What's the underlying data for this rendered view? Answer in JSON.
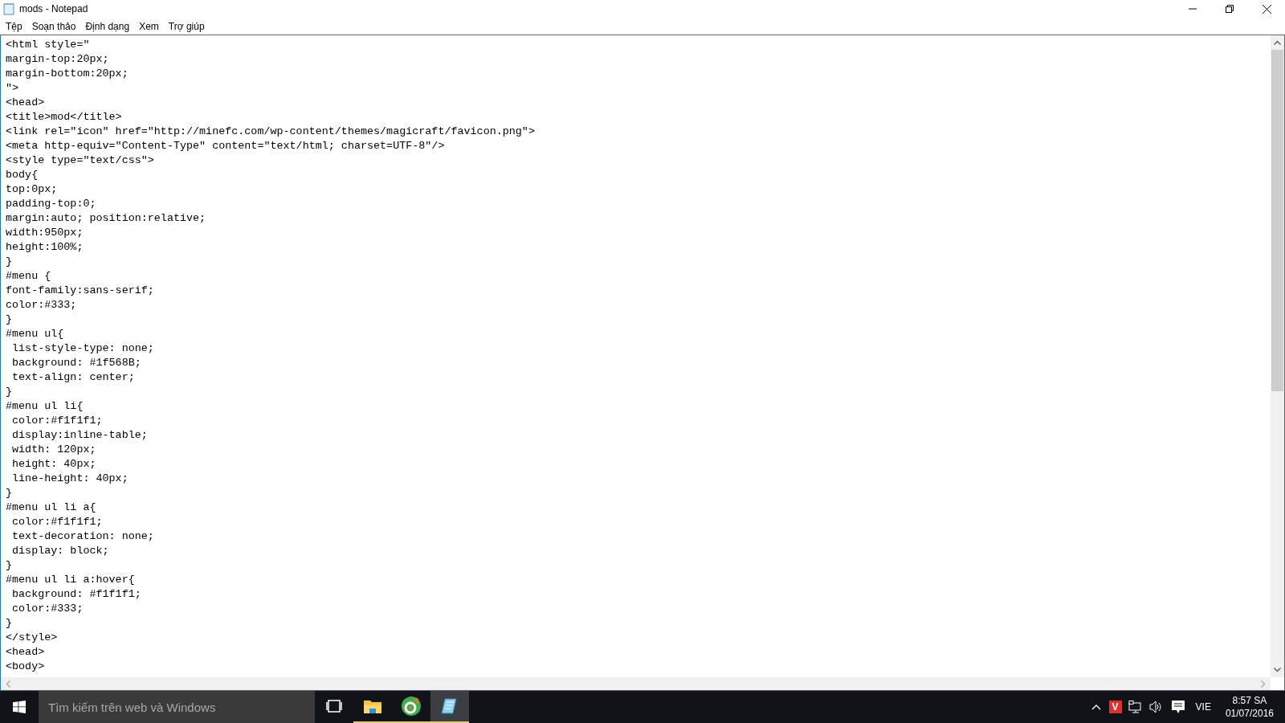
{
  "window": {
    "title": "mods - Notepad"
  },
  "menu": [
    {
      "label": "Tệp"
    },
    {
      "label": "Soạn thảo"
    },
    {
      "label": "Định dạng"
    },
    {
      "label": "Xem"
    },
    {
      "label": "Trợ giúp"
    }
  ],
  "editor": {
    "lines": [
      "<html style=\"",
      "margin-top:20px;",
      "margin-bottom:20px;",
      "\">",
      "<head>",
      "<title>mod</title>",
      "<link rel=\"icon\" href=\"http://minefc.com/wp-content/themes/magicraft/favicon.png\">",
      "<meta http-equiv=\"Content-Type\" content=\"text/html; charset=UTF-8\"/>",
      "<style type=\"text/css\">",
      "body{",
      "top:0px;",
      "padding-top:0;",
      "margin:auto; position:relative;",
      "width:950px;",
      "height:100%;",
      "}",
      "#menu {",
      "font-family:sans-serif;",
      "color:#333;",
      "}",
      "#menu ul{",
      " list-style-type: none;",
      " background: #1f568B;",
      " text-align: center;",
      "}",
      "#menu ul li{",
      " color:#f1f1f1;",
      " display:inline-table;",
      " width: 120px;",
      " height: 40px;",
      " line-height: 40px;",
      "}",
      "#menu ul li a{",
      " color:#f1f1f1;",
      " text-decoration: none;",
      " display: block;",
      "}",
      "#menu ul li a:hover{",
      " background: #f1f1f1;",
      " color:#333;",
      "}",
      "</style>",
      "<head>",
      "<body>"
    ]
  },
  "taskbar": {
    "search": {
      "placeholder": "Tìm kiếm trên web và Windows"
    },
    "apps": [
      {
        "kind": "task-view",
        "selected": false,
        "running": false
      },
      {
        "kind": "folder",
        "selected": false,
        "running": true
      },
      {
        "kind": "browser",
        "selected": false,
        "running": true
      },
      {
        "kind": "notepad",
        "selected": true,
        "running": true
      }
    ],
    "tray": {
      "badge": "V",
      "language": "VIE",
      "time": "8:57 SA",
      "date": "01/07/2016"
    }
  }
}
